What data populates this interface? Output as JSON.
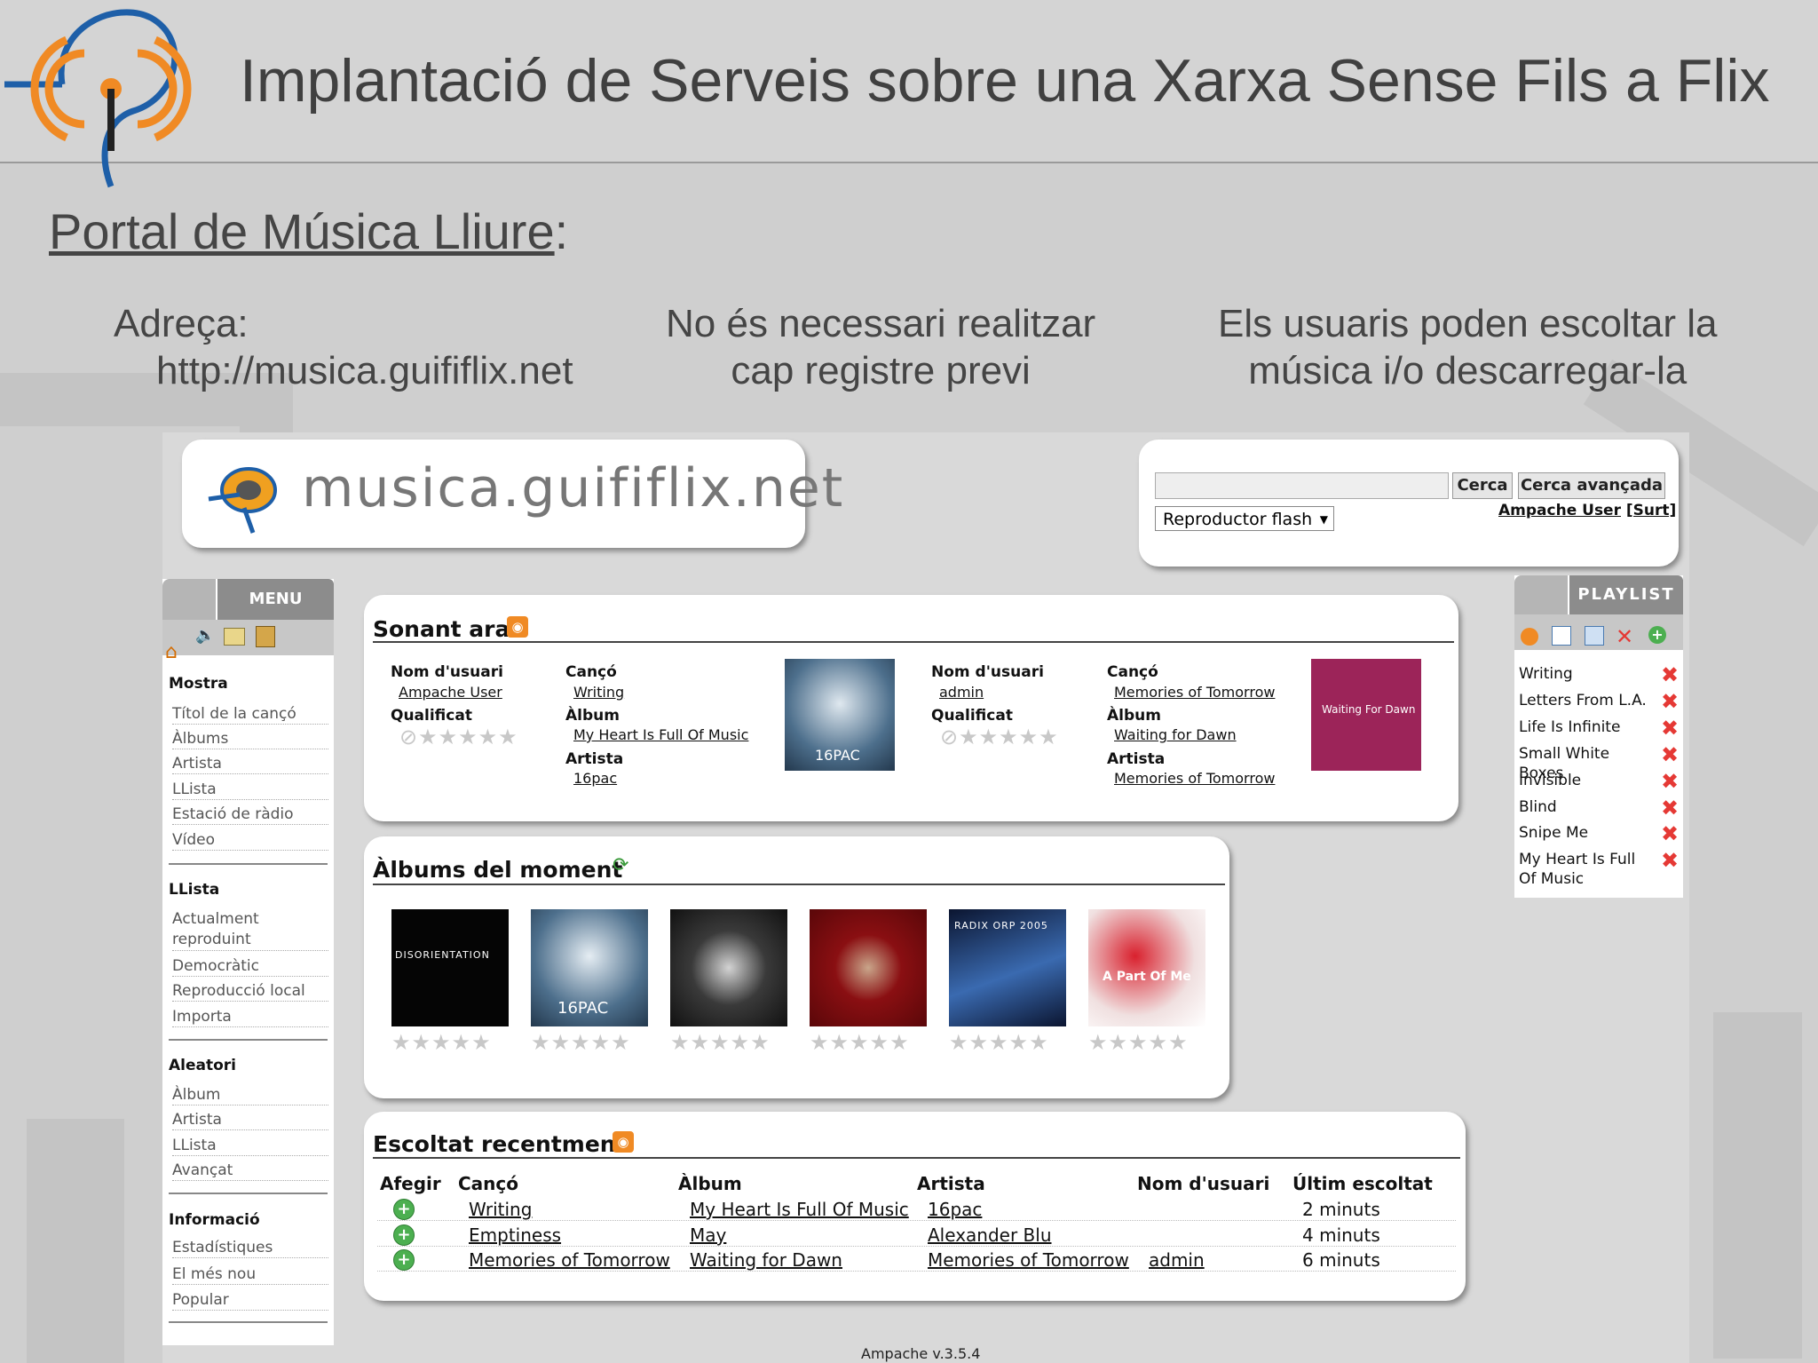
{
  "slide": {
    "title": "Implantació de Serveis sobre una Xarxa Sense Fils a Flix",
    "section_title": "Portal de Música Lliure",
    "section_colon": ":",
    "bullets": [
      {
        "line1": "Adreça:",
        "line2": "http://musica.guififlix.net"
      },
      {
        "line1": "No és necessari realitzar",
        "line2": "cap registre previ"
      },
      {
        "line1": "Els usuaris poden escoltar la",
        "line2": "música i/o descarregar-la"
      }
    ]
  },
  "site": {
    "logo_text": "musica.guififlix.net",
    "search": {
      "value": "",
      "search_label": "Cerca",
      "advanced_label": "Cerca avançada"
    },
    "player_select": "Reproductor flash",
    "user_link": "Ampache User",
    "logout_link": "[Surt]"
  },
  "menu": {
    "tab_label": "MENU",
    "sections": [
      {
        "heading": "Mostra",
        "items": [
          "Títol de la cançó",
          "Àlbums",
          "Artista",
          "LLista",
          "Estació de ràdio",
          "Vídeo"
        ]
      },
      {
        "heading": "LLista",
        "items": [
          "Actualment reproduint",
          "Democràtic",
          "Reproducció local",
          "Importa"
        ]
      },
      {
        "heading": "Aleatori",
        "items": [
          "Àlbum",
          "Artista",
          "LLista",
          "Avançat"
        ]
      },
      {
        "heading": "Informació",
        "items": [
          "Estadístiques",
          "El més nou",
          "Popular"
        ]
      }
    ]
  },
  "now_playing": {
    "title": "Sonant ara",
    "labels": {
      "user": "Nom d'usuari",
      "song": "Cançó",
      "rating": "Qualificat",
      "album": "Àlbum",
      "artist": "Artista"
    },
    "entries": [
      {
        "user": "Ampache User",
        "song": "Writing",
        "album": "My Heart Is Full Of Music",
        "artist": "16pac",
        "cover_text": "16PAC"
      },
      {
        "user": "admin",
        "song": "Memories of Tomorrow",
        "album": "Waiting for Dawn",
        "artist": "Memories of Tomorrow",
        "cover_text": "Waiting For Dawn"
      }
    ]
  },
  "albums_moment": {
    "title": "Àlbums del moment",
    "covers": [
      {
        "text": "DISORIENTATION",
        "color": "#050505"
      },
      {
        "text": "16PAC",
        "color": "#3a5b7a"
      },
      {
        "text": "",
        "color": "#1b1b1b"
      },
      {
        "text": "",
        "color": "#8a0f12"
      },
      {
        "text": "RADIX ORP 2005",
        "color": "#1a2850"
      },
      {
        "text": "A Part Of Me",
        "color": "#e8d6d6"
      }
    ]
  },
  "recent": {
    "title": "Escoltat recentment",
    "headers": [
      "Afegir",
      "Cançó",
      "Àlbum",
      "Artista",
      "Nom d'usuari",
      "Últim escoltat"
    ],
    "rows": [
      {
        "song": "Writing",
        "album": "My Heart Is Full Of Music",
        "artist": "16pac",
        "user": "",
        "when": "2 minuts"
      },
      {
        "song": "Emptiness",
        "album": "May",
        "artist": "Alexander Blu",
        "user": "",
        "when": "4 minuts"
      },
      {
        "song": "Memories of Tomorrow",
        "album": "Waiting for Dawn",
        "artist": "Memories of Tomorrow",
        "user": "admin",
        "when": "6 minuts"
      }
    ]
  },
  "playlist": {
    "tab_label": "PLAYLIST",
    "items": [
      "Writing",
      "Letters From L.A.",
      "Life Is Infinite",
      "Small White Boxes",
      "Invisible",
      "Blind",
      "Snipe Me",
      "My Heart Is Full Of Music"
    ]
  },
  "footer": "Ampache v.3.5.4",
  "colors": {
    "accent_orange": "#f08a24",
    "remove_red": "#e53935",
    "add_green": "#4caf50",
    "tab_grey": "#8c8c8c"
  }
}
